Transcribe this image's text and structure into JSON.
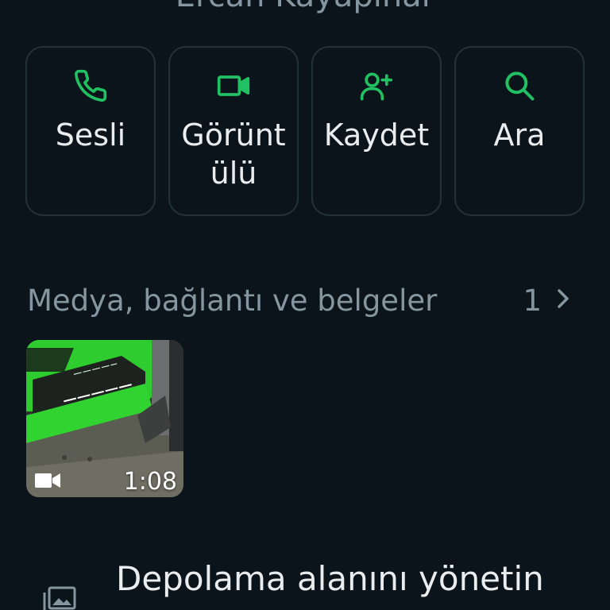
{
  "contact": {
    "name": "Ercan Kayapınar"
  },
  "actions": [
    {
      "label": "Sesli",
      "icon": "phone-icon"
    },
    {
      "label": "Görüntülü",
      "icon": "video-icon"
    },
    {
      "label": "Kaydet",
      "icon": "add-contact-icon"
    },
    {
      "label": "Ara",
      "icon": "search-icon"
    }
  ],
  "media": {
    "title": "Medya, bağlantı ve belgeler",
    "count": "1",
    "items": [
      {
        "type": "video",
        "duration": "1:08",
        "icon": "video-camera-icon"
      }
    ]
  },
  "storage": {
    "label": "Depolama alanını yönetin",
    "icon": "storage-icon"
  },
  "colors": {
    "background": "#0b141a",
    "accent": "#21c063",
    "card_border": "#233138",
    "secondary_text": "#8696a0",
    "primary_text": "#e9edef"
  }
}
